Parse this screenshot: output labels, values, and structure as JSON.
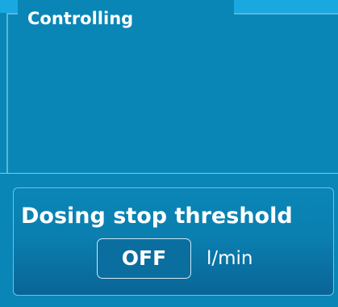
{
  "section": {
    "title": "Controlling"
  },
  "dosing_stop_threshold": {
    "label": "Dosing stop threshold",
    "value": "OFF",
    "unit": "l/min"
  }
}
